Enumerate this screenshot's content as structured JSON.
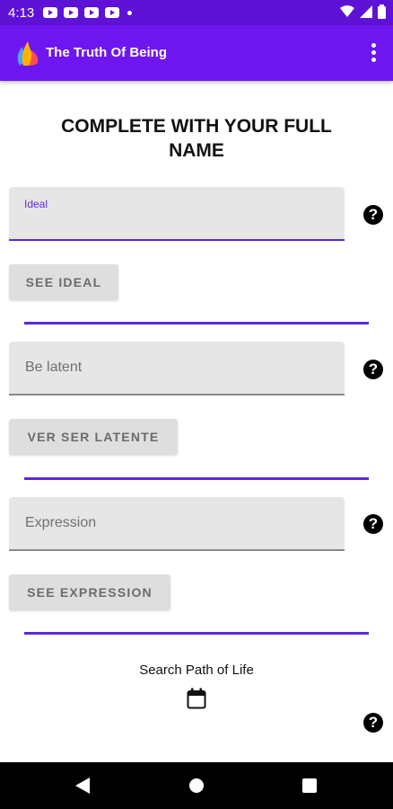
{
  "status_bar": {
    "time": "4:13"
  },
  "app_bar": {
    "title": "The Truth Of Being"
  },
  "heading": "COMPLETE WITH YOUR FULL NAME",
  "fields": {
    "ideal": {
      "label": "Ideal",
      "value": ""
    },
    "be_latent": {
      "placeholder": "Be latent"
    },
    "expression": {
      "placeholder": "Expression"
    }
  },
  "buttons": {
    "see_ideal": "SEE IDEAL",
    "ver_ser_latente": "VER SER LATENTE",
    "see_expression": "SEE EXPRESSION"
  },
  "help_icon_glyph": "?",
  "search_path_label": "Search Path of Life",
  "colors": {
    "status_bar": "#5e12d6",
    "app_bar": "#6d16ef",
    "accent": "#5b2ad8",
    "field_bg": "#e6e6e6",
    "button_bg": "#dedede"
  },
  "icons": [
    "youtube-icon",
    "wifi-icon",
    "signal-icon",
    "battery-icon",
    "app-logo-icon",
    "overflow-menu-icon",
    "help-icon",
    "calendar-icon",
    "back-icon",
    "home-icon",
    "recents-icon"
  ]
}
